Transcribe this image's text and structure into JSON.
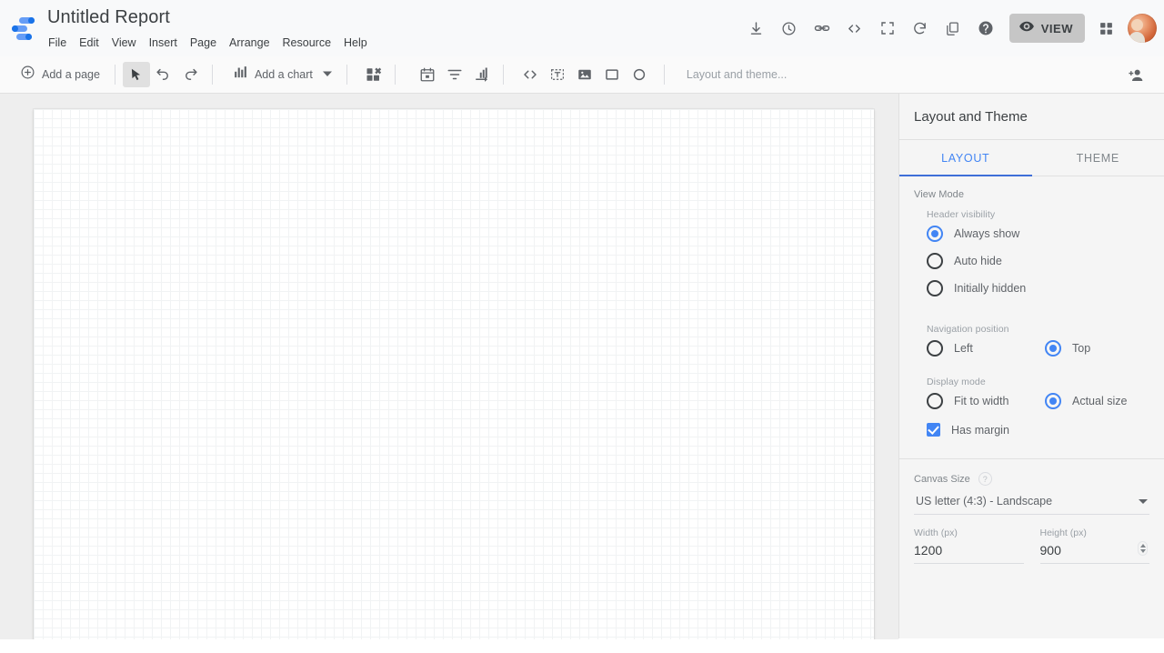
{
  "header": {
    "app_logo": "looker-studio-logo",
    "doc_title": "Untitled Report",
    "menus": [
      "File",
      "Edit",
      "View",
      "Insert",
      "Page",
      "Arrange",
      "Resource",
      "Help"
    ],
    "actions": [
      {
        "name": "download-icon",
        "tooltip": "Download"
      },
      {
        "name": "version-history-icon",
        "tooltip": "Version history"
      },
      {
        "name": "link-icon",
        "tooltip": "Get report link"
      },
      {
        "name": "embed-code-icon",
        "tooltip": "Embed report"
      },
      {
        "name": "fullscreen-icon",
        "tooltip": "Full screen"
      },
      {
        "name": "refresh-icon",
        "tooltip": "Refresh data"
      },
      {
        "name": "copy-icon",
        "tooltip": "Make a copy"
      },
      {
        "name": "help-icon",
        "tooltip": "Help"
      }
    ],
    "view_button": {
      "label": "VIEW",
      "icon": "eye-icon",
      "background": "#c6c6c6"
    },
    "apps_grid": "apps-grid-icon",
    "avatar": "user-avatar"
  },
  "toolbar": {
    "add_page": {
      "label": "Add a page",
      "icon": "plus-circle-icon"
    },
    "select_tool": "cursor-arrow-icon",
    "undo": "undo-icon",
    "redo": "redo-icon",
    "add_chart": {
      "label": "Add a chart",
      "icon": "bar-chart-icon",
      "caret": "chevron-down-icon"
    },
    "add_control": "add-control-icon",
    "date_range": "calendar-icon",
    "filter": "filter-icon",
    "sort": "sort-icon",
    "embed": "embed-code-icon",
    "text": "text-box-icon",
    "image": "image-icon",
    "rectangle": "rectangle-icon",
    "circle": "circle-icon",
    "hint": "Layout and theme...",
    "share": "add-person-icon"
  },
  "canvas": {
    "grid_size_px": 10,
    "background": "#ffffff",
    "workspace_background": "#eeeeee"
  },
  "panel": {
    "title": "Layout and Theme",
    "tabs": [
      {
        "label": "LAYOUT",
        "active": true
      },
      {
        "label": "THEME",
        "active": false
      }
    ],
    "accent_color": "#4285f4",
    "view_mode": {
      "section_label": "View Mode",
      "header_visibility": {
        "label": "Header visibility",
        "options": [
          {
            "label": "Always show",
            "selected": true
          },
          {
            "label": "Auto hide",
            "selected": false
          },
          {
            "label": "Initially hidden",
            "selected": false
          }
        ]
      },
      "navigation_position": {
        "label": "Navigation position",
        "options": [
          {
            "label": "Left",
            "selected": false
          },
          {
            "label": "Top",
            "selected": true
          }
        ]
      },
      "display_mode": {
        "label": "Display mode",
        "options": [
          {
            "label": "Fit to width",
            "selected": false
          },
          {
            "label": "Actual size",
            "selected": true
          }
        ]
      },
      "has_margin": {
        "label": "Has margin",
        "checked": true
      }
    },
    "canvas_size": {
      "label": "Canvas Size",
      "help_glyph": "?",
      "preset": "US letter (4:3) - Landscape",
      "width": {
        "label": "Width (px)",
        "value": "1200"
      },
      "height": {
        "label": "Height (px)",
        "value": "900"
      }
    }
  }
}
